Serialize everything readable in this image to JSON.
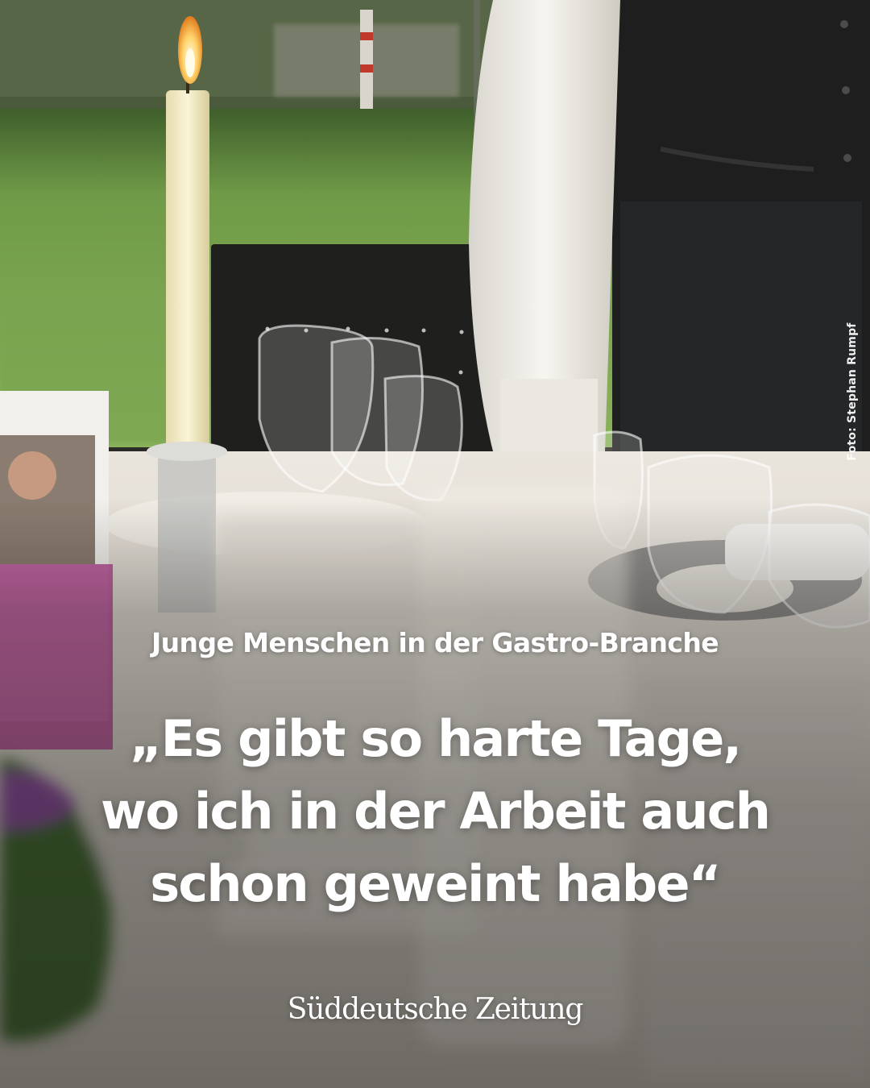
{
  "photo": {
    "credit": "Foto: Stephan Rumpf",
    "depicts": "restaurant-table-setting-with-candle-glasses-and-waiter"
  },
  "article": {
    "kicker": "Junge Menschen in der Gastro-Branche",
    "headline_lines": [
      "„Es gibt so harte Tage,",
      "wo ich in der Arbeit auch",
      "schon geweint habe“"
    ]
  },
  "brand": {
    "name": "Süddeutsche Zeitung"
  },
  "colors": {
    "text": "#ffffff",
    "grass": "#6f9a47",
    "tablecloth": "#e9e4dc",
    "accent_pink": "#b0358a"
  }
}
